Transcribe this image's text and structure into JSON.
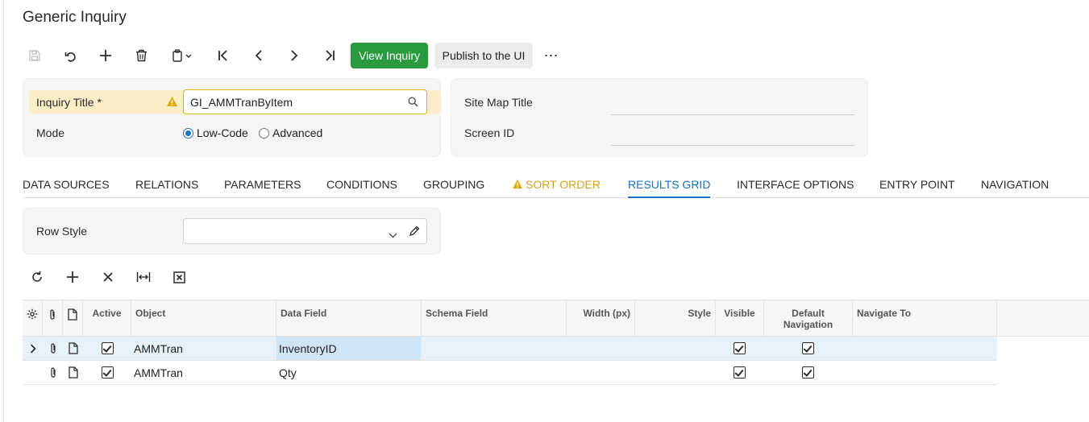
{
  "page": {
    "title": "Generic Inquiry"
  },
  "toolbar": {
    "icons": [
      "save-icon",
      "undo-icon",
      "plus-icon",
      "trash-icon",
      "clipboard-icon",
      "first-icon",
      "previous-icon",
      "next-icon",
      "last-icon"
    ],
    "view_inquiry": "View Inquiry",
    "publish": "Publish to the UI",
    "more": "⋯"
  },
  "form": {
    "inquiry_title_label": "Inquiry Title",
    "required_mark": "*",
    "inquiry_title_value": "GI_AMMTranByItem",
    "mode_label": "Mode",
    "mode_options": [
      "Low-Code",
      "Advanced"
    ],
    "mode_selected": "Low-Code",
    "site_map_title_label": "Site Map Title",
    "site_map_title_value": "",
    "screen_id_label": "Screen ID",
    "screen_id_value": ""
  },
  "tabs": [
    {
      "label": "DATA SOURCES"
    },
    {
      "label": "RELATIONS"
    },
    {
      "label": "PARAMETERS"
    },
    {
      "label": "CONDITIONS"
    },
    {
      "label": "GROUPING"
    },
    {
      "label": "SORT ORDER",
      "warning": true
    },
    {
      "label": "RESULTS GRID",
      "active": true
    },
    {
      "label": "INTERFACE OPTIONS"
    },
    {
      "label": "ENTRY POINT"
    },
    {
      "label": "NAVIGATION"
    }
  ],
  "row_style": {
    "label": "Row Style",
    "value": ""
  },
  "grid_toolbar": {
    "icons": [
      "refresh-icon",
      "add-row-icon",
      "delete-row-icon",
      "fit-columns-icon",
      "export-excel-icon"
    ]
  },
  "grid": {
    "columns": {
      "active": "Active",
      "object": "Object",
      "data_field": "Data Field",
      "schema_field": "Schema Field",
      "width": "Width (px)",
      "style": "Style",
      "visible": "Visible",
      "default_navigation_1": "Default",
      "default_navigation_2": "Navigation",
      "navigate_to": "Navigate To"
    },
    "rows": [
      {
        "active": true,
        "object": "AMMTran",
        "data_field": "InventoryID",
        "schema_field": "",
        "width": "",
        "style": "",
        "visible": true,
        "default_navigation": true,
        "navigate_to": "",
        "selected": true
      },
      {
        "active": true,
        "object": "AMMTran",
        "data_field": "Qty",
        "schema_field": "",
        "width": "",
        "style": "",
        "visible": true,
        "default_navigation": true,
        "navigate_to": "",
        "selected": false
      }
    ]
  },
  "colors": {
    "primary": "#2a9a3f",
    "accent": "#1a73c4",
    "warning": "#d4a11e",
    "required_band": "#fcefc8"
  }
}
